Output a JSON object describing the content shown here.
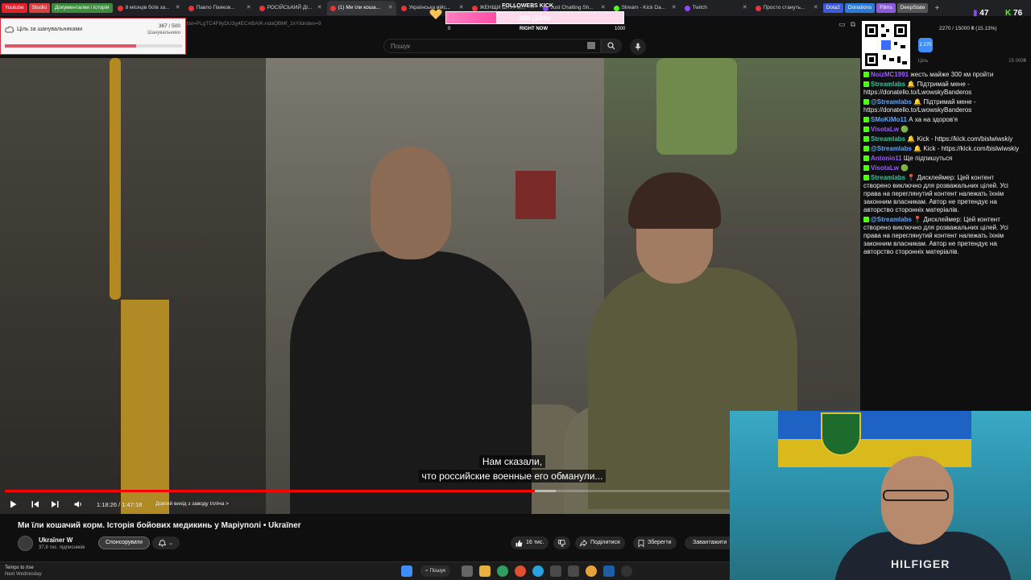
{
  "bookmarks": [
    {
      "label": "Youtube",
      "color": "#e0222b"
    },
    {
      "label": "Studio",
      "color": "#d83f3f"
    },
    {
      "label": "Документалки і історія",
      "color": "#3f8a3f"
    }
  ],
  "tabs": [
    {
      "label": "8 місяців боїв за...",
      "active": false
    },
    {
      "label": "Павло Паяков...",
      "active": false
    },
    {
      "label": "РОСІЙСЬКИЙ ДІ...",
      "active": false
    },
    {
      "label": "(1) Ми їли коша...",
      "active": true
    },
    {
      "label": "Українська війс...",
      "active": false
    },
    {
      "label": "ЖЕНЩИ ШТУРМ...",
      "active": false
    },
    {
      "label": "Just Chatting Sh...",
      "active": false
    },
    {
      "label": "Stream - Kick Da...",
      "active": false
    },
    {
      "label": "Twitch",
      "active": false
    },
    {
      "label": "Просто стануть...",
      "active": false
    }
  ],
  "right_bookmarks": [
    {
      "label": "Dota2",
      "color": "#3d5bd9"
    },
    {
      "label": "Donations",
      "color": "#2a7bd9"
    },
    {
      "label": "Films",
      "color": "#8a5bd9"
    },
    {
      "label": "DeepState",
      "color": "#555555"
    }
  ],
  "address": {
    "url_fragment": "list=PLgTC4F8yDU3g4ECABAIK-ndaQBMf_2xY&index=9"
  },
  "search": {
    "placeholder": "Пошук"
  },
  "goal_overlay": {
    "label": "Ціль за шанувальниками",
    "count": "367 / 500",
    "sub": "Шанувальники",
    "progress": 0.74
  },
  "followers_bar": {
    "title": "FOLLOWERS KICK",
    "text": "289 (28%)",
    "progress": 0.28,
    "min": "0",
    "mid": "RIGHT NOW",
    "max": "1000"
  },
  "top_stats": {
    "viewers_a": "47",
    "viewers_b": "76"
  },
  "fund": {
    "count": "2270 / 15000 ₴ (15.13%)",
    "badge": "2 270",
    "label": "Ціль",
    "max": "15 000₴",
    "progress": 0.1513
  },
  "chat": [
    {
      "user": "NoizMC1991",
      "user_color": "#9b59ff",
      "text": "жесть майже 300 км пройти"
    },
    {
      "user": "Streamlabs",
      "user_color": "#31c3a2",
      "text": "🔔 Підтримай мене - https://donatello.to/LwowskyBanderos"
    },
    {
      "user": "@Streamlabs",
      "user_color": "#5aa7ff",
      "text": "🔔 Підтримай мене - https://donatello.to/LwowskyBanderos"
    },
    {
      "user": "SMoKiMo11",
      "user_color": "#5aa7ff",
      "text": "А ха на здоров'я"
    },
    {
      "user": "VisotaLw",
      "user_color": "#9b59ff",
      "text": "🟢"
    },
    {
      "user": "Streamlabs",
      "user_color": "#31c3a2",
      "text": "🔔 Kick - https://kick.com/bislwiwskiy"
    },
    {
      "user": "@Streamlabs",
      "user_color": "#5aa7ff",
      "text": "🔔 Kick - https://kick.com/bislwiwskiy"
    },
    {
      "user": "Antonio11",
      "user_color": "#9b59ff",
      "text": "Ще підпишуться"
    },
    {
      "user": "VisotaLw",
      "user_color": "#9b59ff",
      "text": "🟢"
    },
    {
      "user": "Streamlabs",
      "user_color": "#31c3a2",
      "text": "📍 Дисклеймер: Цей контент створено виключно для розважальних цілей. Усі права на переглянутий контент належать їхнім законним власникам. Автор не претендує на авторство сторонніх матеріалів."
    },
    {
      "user": "@Streamlabs",
      "user_color": "#5aa7ff",
      "text": "📍 Дисклеймер: Цей контент створено виключно для розважальних цілей. Усі права на переглянутий контент належать їхнім законним власникам. Автор не претендує на авторство сторонніх матеріалів."
    }
  ],
  "player": {
    "subtitle_line1": "Нам сказали,",
    "subtitle_line2": "что российские военные его обманули...",
    "time": "1:18:26 / 1:47:18",
    "chapter": "Довгий вихід з заводу Ілліча >",
    "played": 0.731,
    "buffered": 0.76
  },
  "video": {
    "title": "Ми їли кошачий корм. Історія бойових медикинь у Маріуполі • Ukraïner",
    "channel": "Ukraїner W",
    "subs": "37,6 тис. підписників",
    "sponsor_label": "Спонсорувати",
    "likes": "16 тис.",
    "share_label": "Поділитися",
    "save_label": "Зберегти",
    "download_label": "Завантажити"
  },
  "webcam": {
    "brand": "HILFIGER"
  },
  "taskbar": {
    "weather_title": "Temps to rise",
    "weather_sub": "Next Wednesday",
    "search_label": "Пошук"
  },
  "colors": {
    "accent_red": "#ff0000",
    "chat_bg": "#0f0f0f",
    "followers_pink": "#ff4da6"
  }
}
